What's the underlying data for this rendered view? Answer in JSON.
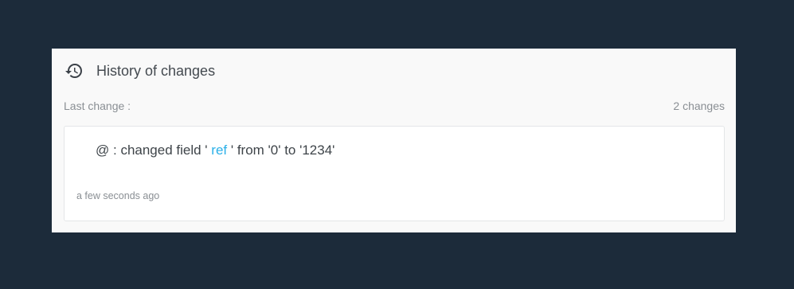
{
  "panel": {
    "icon": "history-icon",
    "title": "History of changes"
  },
  "meta": {
    "last_change_label": "Last change :",
    "changes_count": "2 changes"
  },
  "change": {
    "user_prefix": "@",
    "separator": " : ",
    "action_text": "changed field ' ",
    "field": "ref",
    "from_text": " ' from '0' to '1234'",
    "relative_time": "a few seconds ago"
  },
  "colors": {
    "background": "#1c2b3a",
    "panel": "#f9f9f9",
    "card": "#ffffff",
    "field_accent": "#2bb0e8",
    "muted_text": "#8a8f94"
  }
}
